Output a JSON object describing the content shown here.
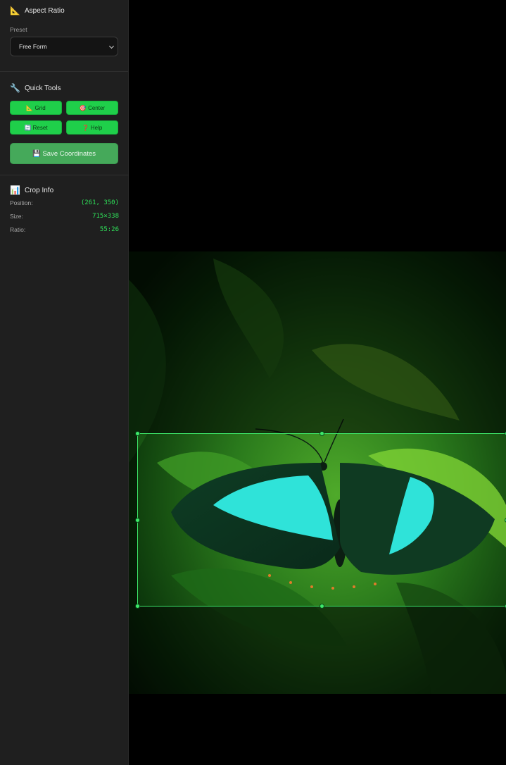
{
  "sidebar": {
    "aspect_ratio": {
      "icon": "triangular-ruler-icon",
      "icon_glyph": "📐",
      "title": "Aspect Ratio",
      "preset_label": "Preset",
      "preset_value": "Free Form"
    },
    "quick_tools": {
      "icon": "wrench-icon",
      "icon_glyph": "🔧",
      "title": "Quick Tools",
      "buttons": [
        {
          "label": "📐 Grid"
        },
        {
          "label": "🎯 Center"
        },
        {
          "label": "🔄 Reset"
        },
        {
          "label": "❓ Help"
        }
      ],
      "save_label": "💾 Save Coordinates"
    },
    "crop_info": {
      "icon": "bar-chart-icon",
      "icon_glyph": "📊",
      "title": "Crop Info",
      "position_label": "Position:",
      "position_value": "(261, 350)",
      "size_label": "Size:",
      "size_value": "715×338",
      "ratio_label": "Ratio:",
      "ratio_value": "55:26"
    }
  },
  "colors": {
    "accent": "#1fcf4a",
    "crop_border": "#3eea6a",
    "sidebar_bg": "#1f1f1f",
    "info_value": "#2fe35a"
  }
}
